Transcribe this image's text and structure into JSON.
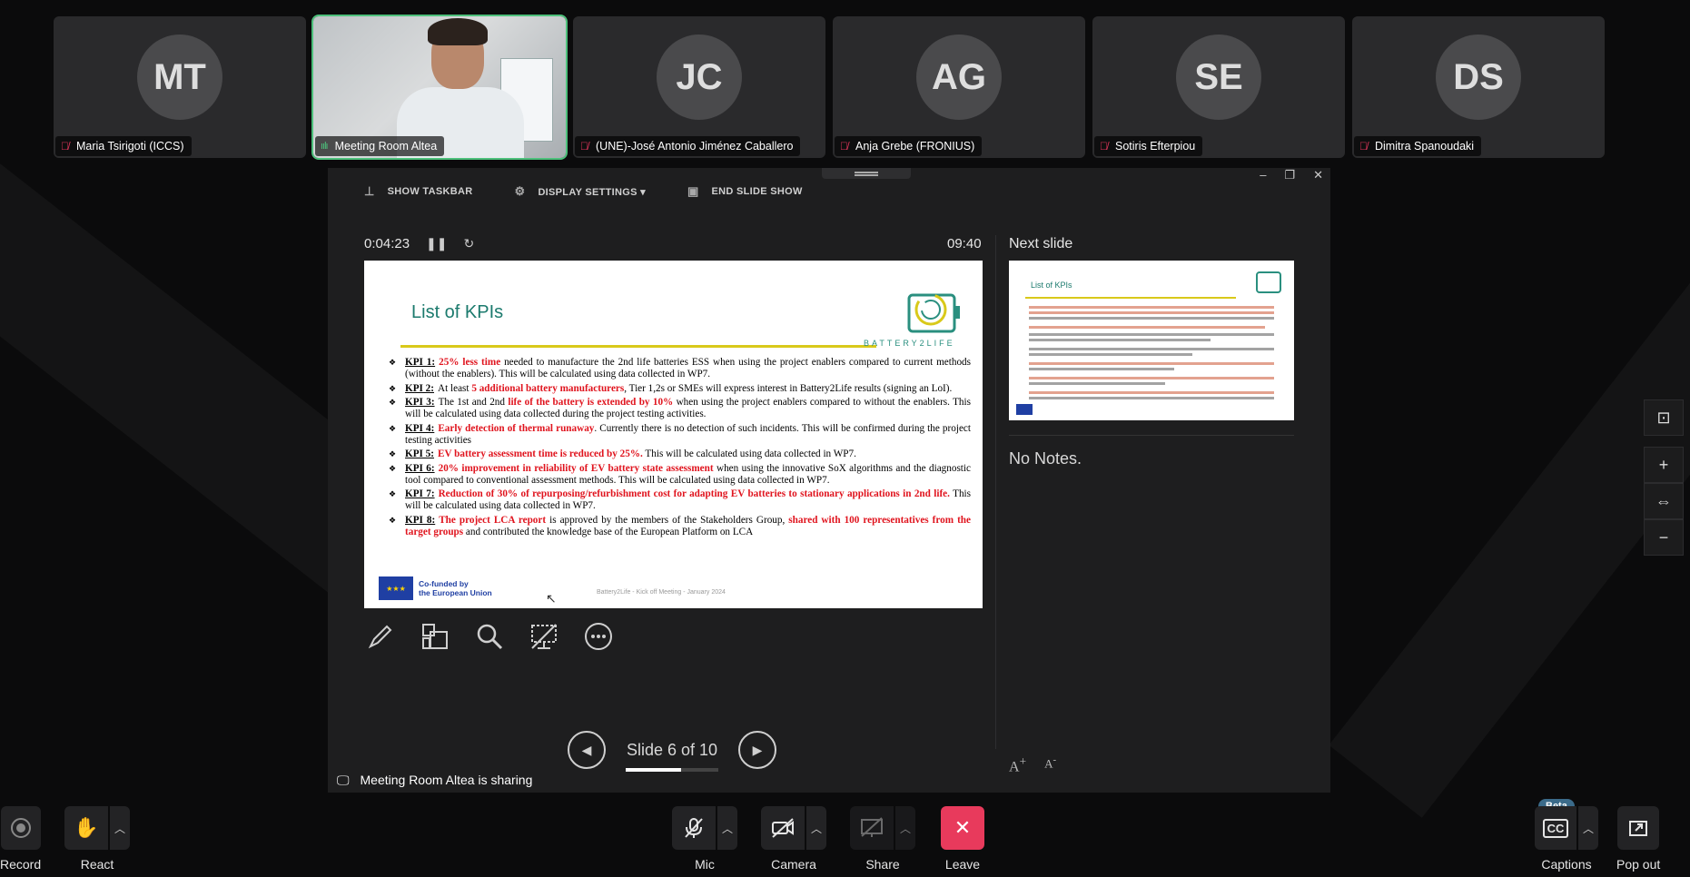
{
  "participants": [
    {
      "initials": "MT",
      "name": "Maria Tsirigoti (ICCS)",
      "muted": true
    },
    {
      "initials": "",
      "name": "Meeting Room Altea",
      "muted": false
    },
    {
      "initials": "JC",
      "name": "(UNE)-José Antonio Jiménez Caballero",
      "muted": true
    },
    {
      "initials": "AG",
      "name": "Anja Grebe (FRONIUS)",
      "muted": true
    },
    {
      "initials": "SE",
      "name": "Sotiris Efterpiou",
      "muted": true
    },
    {
      "initials": "DS",
      "name": "Dimitra Spanoudaki",
      "muted": true
    }
  ],
  "presenter": {
    "toolbar": {
      "show_taskbar": "SHOW TASKBAR",
      "display_settings": "DISPLAY SETTINGS ▾",
      "end_slide_show": "END SLIDE SHOW"
    },
    "timer": "0:04:23",
    "clock": "09:40",
    "next_slide_label": "Next slide",
    "notes": "No Notes.",
    "slide_counter": "Slide 6 of 10",
    "slide_progress": 0.6
  },
  "slide": {
    "title": "List of KPIs",
    "logo_text": "BATTERY2LIFE",
    "kpis": [
      {
        "id": "KPI 1:",
        "parts": [
          {
            "t": "25% less time",
            "red": true
          },
          {
            "t": " needed to manufacture the 2nd life batteries ESS when using the project enablers compared to current methods (without the enablers). This will be calculated using data collected in WP7.",
            "red": false
          }
        ]
      },
      {
        "id": "KPI 2:",
        "parts": [
          {
            "t": "At least ",
            "red": false
          },
          {
            "t": "5 additional battery manufacturers",
            "red": true
          },
          {
            "t": ", Tier 1,2s or SMEs will express interest in Battery2Life results (signing an LoI).",
            "red": false
          }
        ]
      },
      {
        "id": "KPI 3:",
        "parts": [
          {
            "t": "The 1st and 2nd ",
            "red": false
          },
          {
            "t": "life of the battery is extended by 10%",
            "red": true
          },
          {
            "t": " when using the project enablers compared to without the enablers. This will be calculated using data collected during the project testing activities.",
            "red": false
          }
        ]
      },
      {
        "id": "KPI 4:",
        "parts": [
          {
            "t": "Early detection of thermal runaway",
            "red": true
          },
          {
            "t": ". Currently there is no detection of such incidents. This will be confirmed during the project testing activities",
            "red": false
          }
        ]
      },
      {
        "id": "KPI 5:",
        "parts": [
          {
            "t": "EV battery assessment time is reduced by 25%.",
            "red": true
          },
          {
            "t": " This will be calculated using data collected in WP7.",
            "red": false
          }
        ]
      },
      {
        "id": "KPI 6:",
        "parts": [
          {
            "t": "20% improvement in reliability of EV battery state assessment",
            "red": true
          },
          {
            "t": " when using the innovative SoX algorithms and the diagnostic tool compared to conventional assessment methods. This will be calculated using data collected in WP7.",
            "red": false
          }
        ]
      },
      {
        "id": "KPI 7:",
        "parts": [
          {
            "t": "Reduction of 30% of repurposing/refurbishment cost for adapting EV batteries to stationary applications in 2nd life.",
            "red": true
          },
          {
            "t": " This will be calculated using data collected in WP7.",
            "red": false
          }
        ]
      },
      {
        "id": "KPI 8:",
        "parts": [
          {
            "t": "The project LCA report",
            "red": true
          },
          {
            "t": " is approved by the members of the Stakeholders Group, ",
            "red": false
          },
          {
            "t": "shared with 100 representatives from the target groups",
            "red": true
          },
          {
            "t": " and contributed the knowledge base of the European Platform on LCA",
            "red": false
          }
        ]
      }
    ],
    "eu_line1": "Co-funded by",
    "eu_line2": "the European Union",
    "footer": "Battery2Life - Kick off Meeting - January 2024"
  },
  "next_slide": {
    "title": "List of KPIs"
  },
  "sharing_text": "Meeting Room Altea is sharing",
  "controls": {
    "record": "Record",
    "react": "React",
    "mic": "Mic",
    "camera": "Camera",
    "share": "Share",
    "leave": "Leave",
    "captions": "Captions",
    "pop_out": "Pop out",
    "beta": "Beta"
  },
  "colors": {
    "accent_red": "#e83a5c",
    "speaking_green": "#4dc07b",
    "slide_title": "#1b7a6d",
    "slide_red": "#e0141e"
  }
}
